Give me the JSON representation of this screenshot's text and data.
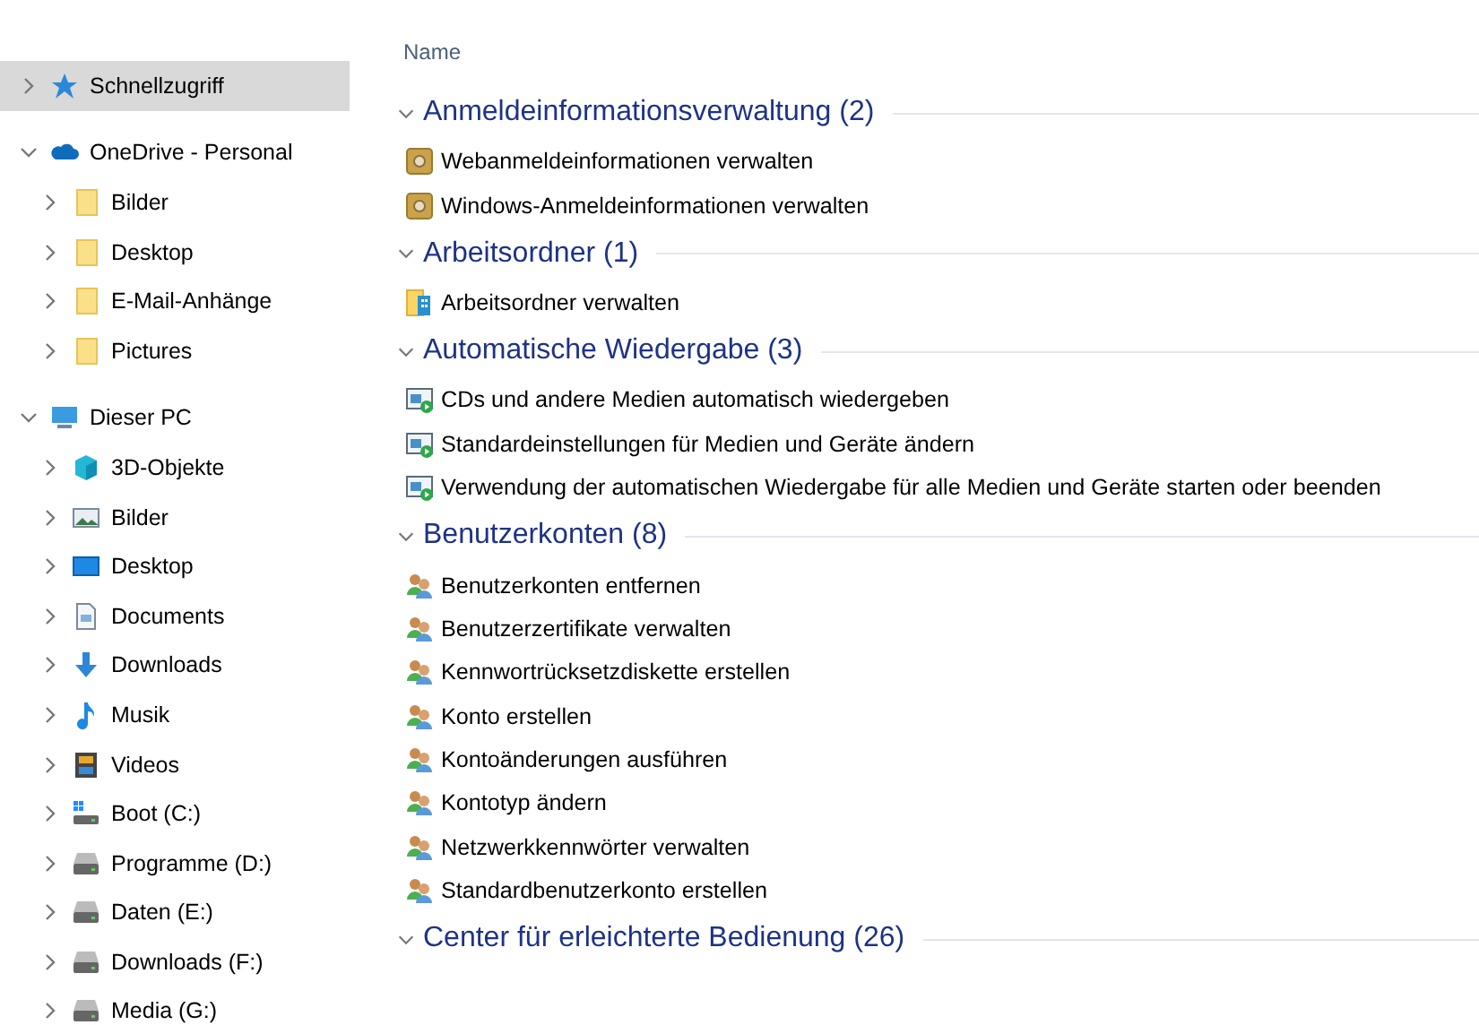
{
  "sidebar": {
    "items": [
      {
        "label": "Schnellzugriff",
        "kind": "quick-access",
        "expanded": false,
        "selected": true
      },
      {
        "label": "OneDrive - Personal",
        "kind": "cloud",
        "expanded": true,
        "selected": false,
        "children": [
          {
            "label": "Bilder",
            "kind": "folder",
            "expanded": false,
            "selected": false
          },
          {
            "label": "Desktop",
            "kind": "folder",
            "expanded": false,
            "selected": false
          },
          {
            "label": "E-Mail-Anhänge",
            "kind": "folder",
            "expanded": false,
            "selected": false
          },
          {
            "label": "Pictures",
            "kind": "folder",
            "expanded": false,
            "selected": false
          }
        ]
      },
      {
        "label": "Dieser PC",
        "kind": "pc",
        "expanded": true,
        "selected": false,
        "children": [
          {
            "label": "3D-Objekte",
            "kind": "cube",
            "expanded": false,
            "selected": false
          },
          {
            "label": "Bilder",
            "kind": "pictures",
            "expanded": false,
            "selected": false
          },
          {
            "label": "Desktop",
            "kind": "desktop",
            "expanded": false,
            "selected": false
          },
          {
            "label": "Documents",
            "kind": "documents",
            "expanded": false,
            "selected": false
          },
          {
            "label": "Downloads",
            "kind": "downloads",
            "expanded": false,
            "selected": false
          },
          {
            "label": "Musik",
            "kind": "music",
            "expanded": false,
            "selected": false
          },
          {
            "label": "Videos",
            "kind": "videos",
            "expanded": false,
            "selected": false
          },
          {
            "label": "Boot (C:)",
            "kind": "system-drive",
            "expanded": false,
            "selected": false
          },
          {
            "label": "Programme (D:)",
            "kind": "drive",
            "expanded": false,
            "selected": false
          },
          {
            "label": "Daten (E:)",
            "kind": "drive",
            "expanded": false,
            "selected": false
          },
          {
            "label": "Downloads (F:)",
            "kind": "drive",
            "expanded": false,
            "selected": false
          },
          {
            "label": "Media (G:)",
            "kind": "drive",
            "expanded": false,
            "selected": false
          }
        ]
      }
    ]
  },
  "list": {
    "column_header": "Name",
    "groups": [
      {
        "title": "Anmeldeinformationsverwaltung (2)",
        "expanded": true,
        "items": [
          {
            "label": "Webanmeldeinformationen verwalten",
            "kind": "vault"
          },
          {
            "label": "Windows-Anmeldeinformationen verwalten",
            "kind": "vault"
          }
        ]
      },
      {
        "title": "Arbeitsordner (1)",
        "expanded": true,
        "items": [
          {
            "label": "Arbeitsordner verwalten",
            "kind": "work-folder"
          }
        ]
      },
      {
        "title": "Automatische Wiedergabe (3)",
        "expanded": true,
        "items": [
          {
            "label": "CDs und andere Medien automatisch wiedergeben",
            "kind": "autoplay"
          },
          {
            "label": "Standardeinstellungen für Medien und Geräte ändern",
            "kind": "autoplay"
          },
          {
            "label": "Verwendung der automatischen Wiedergabe für alle Medien und Geräte starten oder beenden",
            "kind": "autoplay"
          }
        ]
      },
      {
        "title": "Benutzerkonten (8)",
        "expanded": true,
        "items": [
          {
            "label": "Benutzerkonten entfernen",
            "kind": "users"
          },
          {
            "label": "Benutzerzertifikate verwalten",
            "kind": "users"
          },
          {
            "label": "Kennwortrücksetzdiskette erstellen",
            "kind": "users"
          },
          {
            "label": "Konto erstellen",
            "kind": "users"
          },
          {
            "label": "Kontoänderungen ausführen",
            "kind": "users"
          },
          {
            "label": "Kontotyp ändern",
            "kind": "users"
          },
          {
            "label": "Netzwerkkennwörter verwalten",
            "kind": "users"
          },
          {
            "label": "Standardbenutzerkonto erstellen",
            "kind": "users"
          }
        ]
      },
      {
        "title": "Center für erleichterte Bedienung (26)",
        "expanded": true
      }
    ]
  }
}
